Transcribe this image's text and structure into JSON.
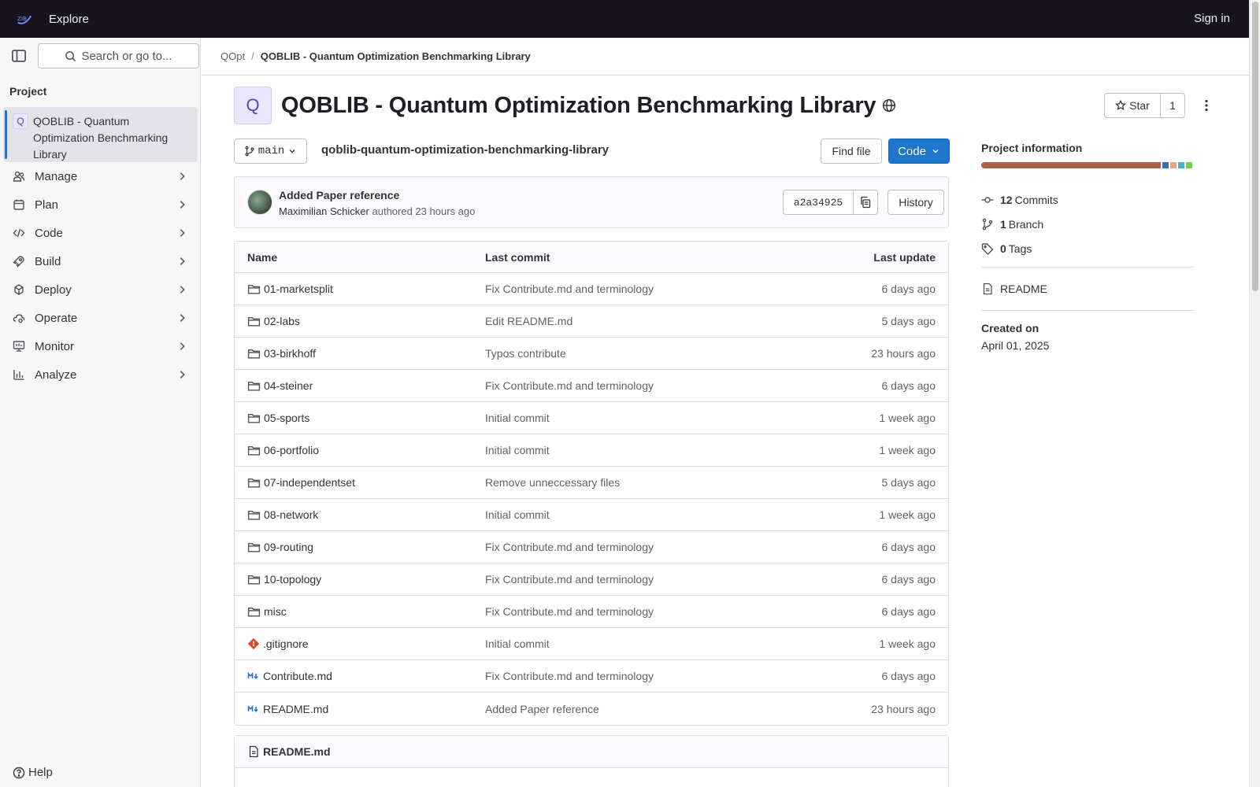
{
  "topbar": {
    "explore": "Explore",
    "signin": "Sign in"
  },
  "sidebar": {
    "search_placeholder": "Search or go to...",
    "section": "Project",
    "project_initial": "Q",
    "project_name": "QOBLIB - Quantum Optimization Benchmarking Library",
    "items": [
      {
        "label": "Manage",
        "icon": "users-icon"
      },
      {
        "label": "Plan",
        "icon": "calendar-icon"
      },
      {
        "label": "Code",
        "icon": "code-icon"
      },
      {
        "label": "Build",
        "icon": "rocket-icon"
      },
      {
        "label": "Deploy",
        "icon": "deploy-icon"
      },
      {
        "label": "Operate",
        "icon": "cloud-gear-icon"
      },
      {
        "label": "Monitor",
        "icon": "monitor-icon"
      },
      {
        "label": "Analyze",
        "icon": "chart-icon"
      }
    ],
    "help": "Help"
  },
  "breadcrumb": {
    "group": "QOpt",
    "project": "QOBLIB - Quantum Optimization Benchmarking Library"
  },
  "project": {
    "initial": "Q",
    "title": "QOBLIB - Quantum Optimization Benchmarking Library",
    "star_label": "Star",
    "star_count": "1"
  },
  "repo": {
    "branch": "main",
    "path": "qoblib-quantum-optimization-benchmarking-library",
    "find_file": "Find file",
    "code": "Code"
  },
  "commit": {
    "message": "Added Paper reference",
    "author": "Maximilian Schicker",
    "authored_text": "authored 23 hours ago",
    "sha": "a2a34925",
    "history": "History"
  },
  "table": {
    "headers": {
      "name": "Name",
      "last_commit": "Last commit",
      "last_update": "Last update"
    },
    "rows": [
      {
        "name": "01-marketsplit",
        "type": "folder",
        "commit": "Fix Contribute.md and terminology",
        "date": "6 days ago"
      },
      {
        "name": "02-labs",
        "type": "folder",
        "commit": "Edit README.md",
        "date": "5 days ago"
      },
      {
        "name": "03-birkhoff",
        "type": "folder",
        "commit": "Typos contribute",
        "date": "23 hours ago"
      },
      {
        "name": "04-steiner",
        "type": "folder",
        "commit": "Fix Contribute.md and terminology",
        "date": "6 days ago"
      },
      {
        "name": "05-sports",
        "type": "folder",
        "commit": "Initial commit",
        "date": "1 week ago"
      },
      {
        "name": "06-portfolio",
        "type": "folder",
        "commit": "Initial commit",
        "date": "1 week ago"
      },
      {
        "name": "07-independentset",
        "type": "folder",
        "commit": "Remove unneccessary files",
        "date": "5 days ago"
      },
      {
        "name": "08-network",
        "type": "folder",
        "commit": "Initial commit",
        "date": "1 week ago"
      },
      {
        "name": "09-routing",
        "type": "folder",
        "commit": "Fix Contribute.md and terminology",
        "date": "6 days ago"
      },
      {
        "name": "10-topology",
        "type": "folder",
        "commit": "Fix Contribute.md and terminology",
        "date": "6 days ago"
      },
      {
        "name": "misc",
        "type": "folder",
        "commit": "Fix Contribute.md and terminology",
        "date": "6 days ago"
      },
      {
        "name": ".gitignore",
        "type": "git",
        "commit": "Initial commit",
        "date": "1 week ago"
      },
      {
        "name": "Contribute.md",
        "type": "markdown",
        "commit": "Fix Contribute.md and terminology",
        "date": "6 days ago"
      },
      {
        "name": "README.md",
        "type": "markdown",
        "commit": "Added Paper reference",
        "date": "23 hours ago"
      }
    ]
  },
  "readme": {
    "title": "README.md"
  },
  "info": {
    "title": "Project information",
    "languages": [
      {
        "color": "#a96447",
        "share": 85
      },
      {
        "color": "#3572a5",
        "share": 3
      },
      {
        "color": "#e6a483",
        "share": 3
      },
      {
        "color": "#4fb3b0",
        "share": 3
      },
      {
        "color": "#6cd34f",
        "share": 3
      }
    ],
    "commits_count": "12",
    "commits_label": "Commits",
    "branch_count": "1",
    "branch_label": "Branch",
    "tags_count": "0",
    "tags_label": "Tags",
    "readme": "README",
    "created_label": "Created on",
    "created_date": "April 01, 2025"
  },
  "colors": {
    "topbar": "#171321",
    "primary": "#1f75cb",
    "sidebar": "#f7f7f8"
  }
}
